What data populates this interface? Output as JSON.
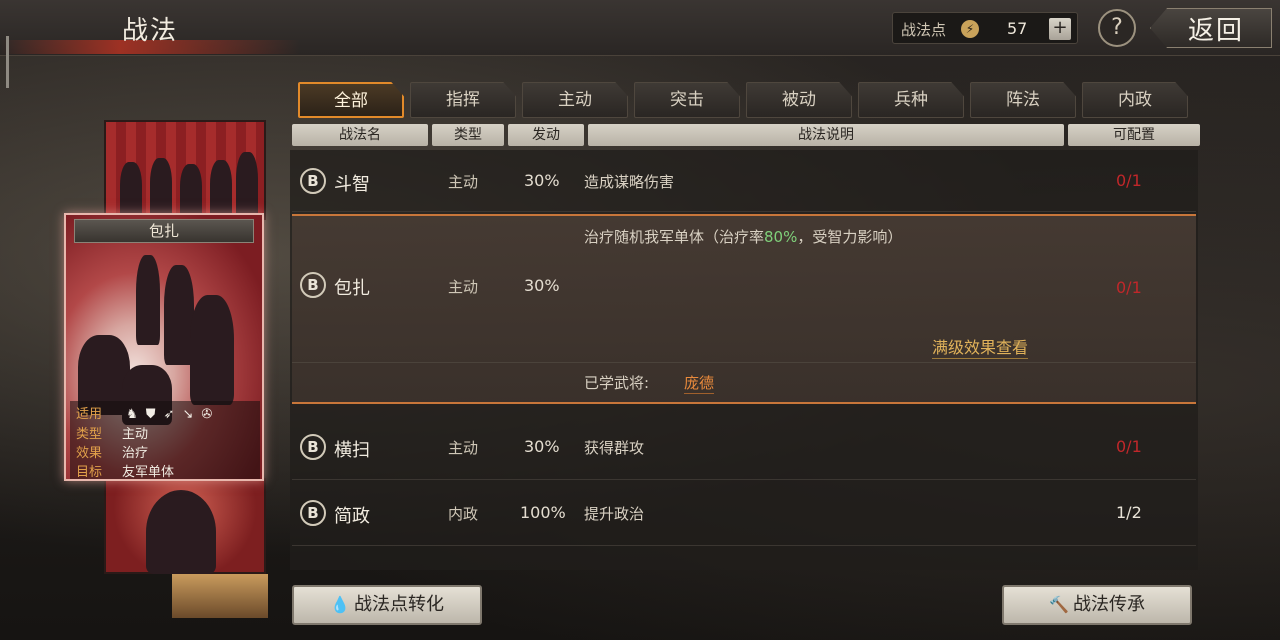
{
  "header": {
    "title": "战法",
    "points_label": "战法点",
    "points_value": "57",
    "plus_label": "+",
    "help_label": "?",
    "back_label": "返回"
  },
  "card": {
    "name": "包扎",
    "info": [
      {
        "key": "适用",
        "value": ""
      },
      {
        "key": "类型",
        "value": "主动"
      },
      {
        "key": "效果",
        "value": "治疗"
      },
      {
        "key": "目标",
        "value": "友军单体"
      }
    ],
    "troop_icons": [
      "cavalry-icon",
      "shield-icon",
      "bow-icon",
      "spear-icon",
      "wheel-icon"
    ]
  },
  "tabs": [
    {
      "label": "全部",
      "active": true
    },
    {
      "label": "指挥",
      "active": false
    },
    {
      "label": "主动",
      "active": false
    },
    {
      "label": "突击",
      "active": false
    },
    {
      "label": "被动",
      "active": false
    },
    {
      "label": "兵种",
      "active": false
    },
    {
      "label": "阵法",
      "active": false
    },
    {
      "label": "内政",
      "active": false
    }
  ],
  "columns": {
    "name": "战法名",
    "type": "类型",
    "rate": "发动",
    "desc": "战法说明",
    "config": "可配置"
  },
  "rows": [
    {
      "grade": "B",
      "name": "斗智",
      "type": "主动",
      "rate": "30%",
      "desc": "造成谋略伤害",
      "count": "0/1",
      "count_color": "#c0272a"
    },
    {
      "grade": "B",
      "name": "包扎",
      "type": "主动",
      "rate": "30%",
      "desc_prefix": "治疗随机我军单体（治疗率",
      "desc_highlight": "80%",
      "desc_suffix": "，受智力影响）",
      "count": "0/1",
      "count_color": "#c0272a",
      "view_full": "满级效果查看",
      "learned_label": "已学武将:",
      "learned_name": "庞德"
    },
    {
      "grade": "B",
      "name": "横扫",
      "type": "主动",
      "rate": "30%",
      "desc": "获得群攻",
      "count": "0/1",
      "count_color": "#c0272a"
    },
    {
      "grade": "B",
      "name": "简政",
      "type": "内政",
      "rate": "100%",
      "desc": "提升政治",
      "count": "1/2",
      "count_color": "#e9e3d7"
    }
  ],
  "buttons": {
    "convert": "战法点转化",
    "inherit": "战法传承"
  },
  "colors": {
    "accent_orange": "#e28a2a",
    "count_red": "#c0272a",
    "highlight_green": "#7fd07a",
    "link_gold": "#e0b25a"
  }
}
